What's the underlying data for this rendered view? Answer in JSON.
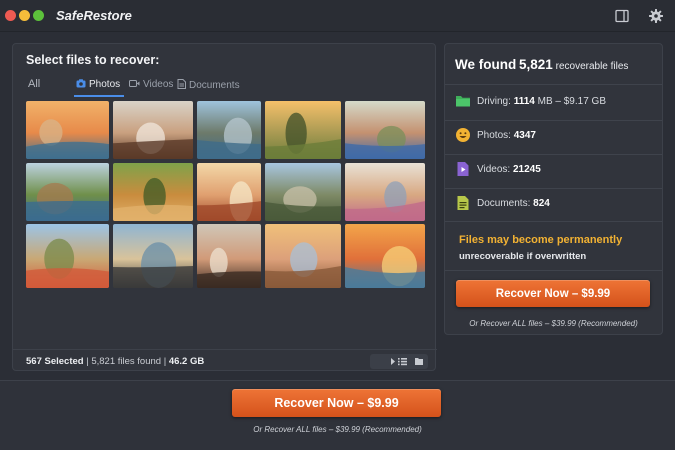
{
  "app": {
    "title": "SafeRestore"
  },
  "left": {
    "title": "Select files to recover:",
    "tabs": [
      {
        "label": "All",
        "icon": "all"
      },
      {
        "label": "Photos",
        "icon": "camera-icon",
        "active": true
      },
      {
        "label": "Videos",
        "icon": "video-icon"
      },
      {
        "label": "Documents",
        "icon": "document-icon"
      }
    ],
    "thumbnails": [
      {
        "subject": "beach sunset",
        "colors": [
          "#f1b26a",
          "#e78a4a",
          "#3f6f8e",
          "#d8b48a"
        ]
      },
      {
        "subject": "smiling couple",
        "colors": [
          "#d9d3c8",
          "#c9a07f",
          "#5a3a28",
          "#f0e7dc"
        ]
      },
      {
        "subject": "mountain lake",
        "colors": [
          "#9fc3dd",
          "#6d7a6a",
          "#3f6c8a",
          "#b7c7cf"
        ]
      },
      {
        "subject": "couple on hill",
        "colors": [
          "#f5c06a",
          "#a99a53",
          "#6b7d3a",
          "#3f4f28"
        ]
      },
      {
        "subject": "family with child",
        "colors": [
          "#d5d9c9",
          "#c49170",
          "#3f6aa8",
          "#7a8f5a"
        ]
      },
      {
        "subject": "coastline",
        "colors": [
          "#bcd2e0",
          "#6f8f4a",
          "#3b6b8f",
          "#a67a4f"
        ]
      },
      {
        "subject": "golden retriever",
        "colors": [
          "#7fa24a",
          "#c98c3e",
          "#e1b06a",
          "#3d5a26"
        ]
      },
      {
        "subject": "smiling boy",
        "colors": [
          "#f3d8a8",
          "#e0a070",
          "#a04a2a",
          "#f6e8c8"
        ]
      },
      {
        "subject": "cyclist on road",
        "colors": [
          "#a8c6e0",
          "#7e8a66",
          "#4a5a3a",
          "#c8c0a8"
        ]
      },
      {
        "subject": "mother and children",
        "colors": [
          "#e9e2d6",
          "#d8a882",
          "#c06a8a",
          "#8fa0b8"
        ]
      },
      {
        "subject": "kids jumping",
        "colors": [
          "#9cc4e6",
          "#c9a874",
          "#d25a3a",
          "#7a8a4a"
        ]
      },
      {
        "subject": "cyclist at lake",
        "colors": [
          "#8fb5d3",
          "#d9c39a",
          "#3a3a3a",
          "#6a8fa8"
        ]
      },
      {
        "subject": "smiling couple portrait",
        "colors": [
          "#cfc7b8",
          "#d19a78",
          "#3a2a22",
          "#eee2d0"
        ]
      },
      {
        "subject": "family selfie",
        "colors": [
          "#f0c07a",
          "#dca07a",
          "#8a5a3a",
          "#a8c0d8"
        ]
      },
      {
        "subject": "sunset beach",
        "colors": [
          "#f3a54a",
          "#e0703a",
          "#4a7a9a",
          "#f7d27a"
        ]
      }
    ],
    "footer": {
      "selected": "567 Selected",
      "found": "5,821 files found",
      "size": "46.2 GB"
    }
  },
  "right": {
    "found_prefix": "We found",
    "found_count": "5,821",
    "found_suffix": "recoverable files",
    "stats": [
      {
        "label": "Driving:",
        "value": "1114",
        "extra": "MB – $9.17 GB",
        "icon": "folder-icon",
        "color": "#3fae5a"
      },
      {
        "label": "Photos:",
        "value": "4347",
        "icon": "smiley-icon",
        "color": "#f2b233"
      },
      {
        "label": "Videos:",
        "value": "21245",
        "icon": "video-file-icon",
        "color": "#8a63d2"
      },
      {
        "label": "Documents:",
        "value": "824",
        "icon": "document-file-icon",
        "color": "#b8c84a"
      }
    ],
    "warning_line1": "Files may become permanently",
    "warning_line2": "unrecoverable if overwritten",
    "button": "Recover Now – $9.99",
    "alt": "Or Recover ALL files – $39.99 (Recommended)"
  },
  "bottom": {
    "button": "Recover Now – $9.99",
    "alt": "Or Recover ALL files – $39.99 (Recommended)"
  },
  "colors": {
    "accent": "#4a8de8",
    "cta": "#e0612a",
    "warning": "#f2b233"
  }
}
